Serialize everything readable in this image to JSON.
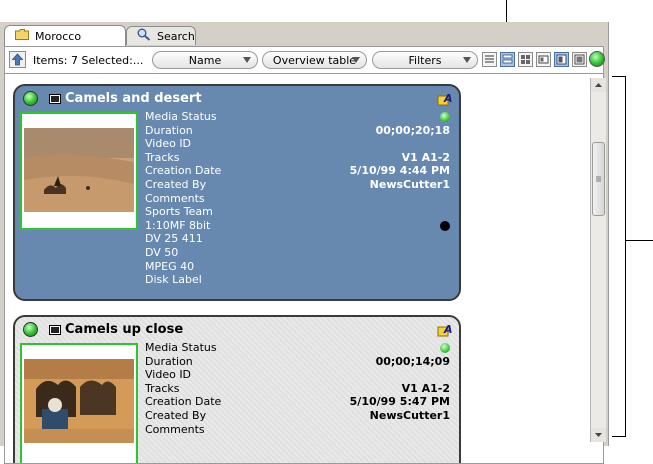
{
  "tabs": [
    {
      "label": "Morocco",
      "icon": "folder-icon",
      "active": true
    },
    {
      "label": "Search",
      "icon": "magnifier-icon",
      "active": false
    }
  ],
  "toolbar": {
    "items_label": "Items: 7 Selected:...",
    "name_dropdown": "Name",
    "view_dropdown": "Overview table",
    "filters_dropdown": "Filters"
  },
  "cards": [
    {
      "title": "Camels and desert",
      "fields": [
        {
          "key": "Media Status",
          "value": ""
        },
        {
          "key": "Duration",
          "value": "00;00;20;18"
        },
        {
          "key": "Video ID",
          "value": ""
        },
        {
          "key": "Tracks",
          "value": "V1 A1-2"
        },
        {
          "key": "Creation Date",
          "value": "5/10/99 4:44 PM"
        },
        {
          "key": "Created By",
          "value": "NewsCutter1"
        },
        {
          "key": "Comments",
          "value": ""
        },
        {
          "key": "Sports Team",
          "value": ""
        },
        {
          "key": "1:10MF 8bit",
          "value": ""
        },
        {
          "key": "DV 25 411",
          "value": ""
        },
        {
          "key": "DV 50",
          "value": ""
        },
        {
          "key": "MPEG 40",
          "value": ""
        },
        {
          "key": "Disk Label",
          "value": ""
        }
      ]
    },
    {
      "title": "Camels up close",
      "fields": [
        {
          "key": "Media Status",
          "value": ""
        },
        {
          "key": "Duration",
          "value": "00;00;14;09"
        },
        {
          "key": "Video ID",
          "value": ""
        },
        {
          "key": "Tracks",
          "value": "V1 A1-2"
        },
        {
          "key": "Creation Date",
          "value": "5/10/99 5:47 PM"
        },
        {
          "key": "Created By",
          "value": "NewsCutter1"
        },
        {
          "key": "Comments",
          "value": ""
        }
      ]
    }
  ],
  "colors": {
    "card_selected": "#6789b0",
    "status_online": "#2fbf2f",
    "thumb_border": "#31c431"
  }
}
